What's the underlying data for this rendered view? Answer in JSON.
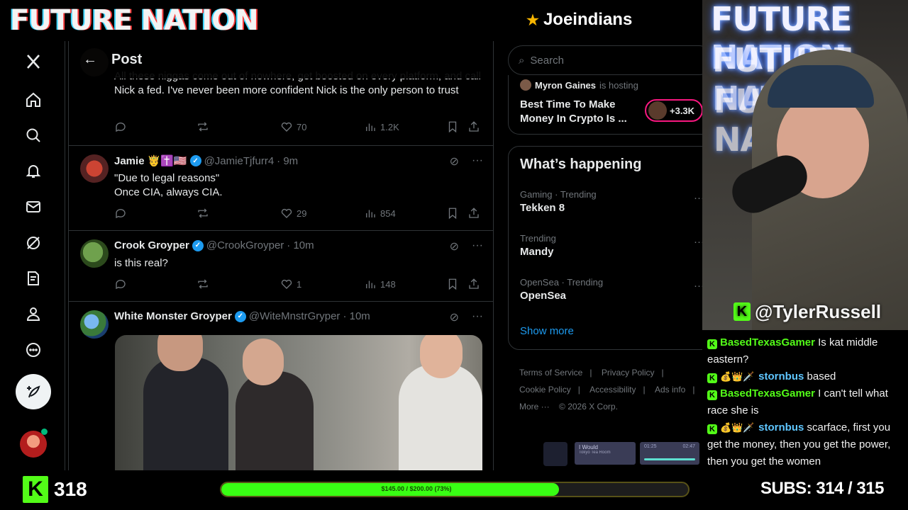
{
  "brand": {
    "logo": "FUTURE NATION",
    "partner": "Joeindians"
  },
  "rail": {
    "items": [
      "x-logo",
      "home",
      "explore",
      "notifications",
      "messages",
      "grok",
      "lists",
      "profile",
      "more"
    ]
  },
  "post_header": {
    "back": "←",
    "title": "Post"
  },
  "tweets": [
    {
      "body": "All these niggas come out of nowhere, get boosted on every platform, and call Nick a fed. I've never been more confident Nick is the only person to trust",
      "likes": "70",
      "views": "1.2K"
    },
    {
      "name": "Jamie",
      "emoji": "🤴✝️🇺🇸",
      "handle": "@JamieTjfurr4",
      "time": "· 9m",
      "body_lines": [
        "\"Due to legal reasons\"",
        "Once CIA, always CIA."
      ],
      "likes": "29",
      "views": "854"
    },
    {
      "name": "Crook Groyper",
      "handle": "@CrookGroyper",
      "time": "· 10m",
      "body": "is this real?",
      "likes": "1",
      "views": "148"
    },
    {
      "name": "White Monster Groyper",
      "handle": "@WiteMnstrGryper",
      "time": "· 10m"
    }
  ],
  "search": {
    "placeholder": "Search"
  },
  "space": {
    "host": "Myron Gaines",
    "host_suffix": "is hosting",
    "title": "Best Time To Make Money In Crypto Is ...",
    "listeners": "+3.3K"
  },
  "trends": {
    "title": "What’s happening",
    "items": [
      {
        "context": "Gaming · Trending",
        "name": "Tekken 8"
      },
      {
        "context": "Trending",
        "name": "Mandy"
      },
      {
        "context": "OpenSea · Trending",
        "name": "OpenSea"
      }
    ],
    "show_more": "Show more"
  },
  "footer": {
    "links": [
      "Terms of Service",
      "Privacy Policy",
      "Cookie Policy",
      "Accessibility",
      "Ads info",
      "More ···",
      "© 2026 X Corp."
    ]
  },
  "music": {
    "title": "I Would",
    "artist": "Tokyo Tea Room",
    "elapsed": "01:25",
    "duration": "02:47"
  },
  "cam": {
    "sign": "FUTURE NATION",
    "handle": "@TylerRussell"
  },
  "chat": [
    {
      "user": "BasedTexasGamer",
      "color": "green",
      "badges": "",
      "msg": "Is kat middle eastern?"
    },
    {
      "user": "stornbus",
      "color": "blue",
      "badges": "💰👑🗡️",
      "msg": "based"
    },
    {
      "user": "BasedTexasGamer",
      "color": "green",
      "badges": "",
      "msg": "I can't tell what race she is"
    },
    {
      "user": "stornbus",
      "color": "blue",
      "badges": "💰👑🗡️",
      "msg": "scarface, first you get the money, then you get the power, then you get the women"
    }
  ],
  "bottom": {
    "followers": "318",
    "goal_text": "$145.00 / $200.00 (73%)",
    "goal_progress": 0.73,
    "subs": "SUBS:  314 / 315"
  },
  "colors": {
    "kick_green": "#53fc18",
    "x_blue": "#1d9bf0",
    "goal_fill": "#39ff14"
  }
}
